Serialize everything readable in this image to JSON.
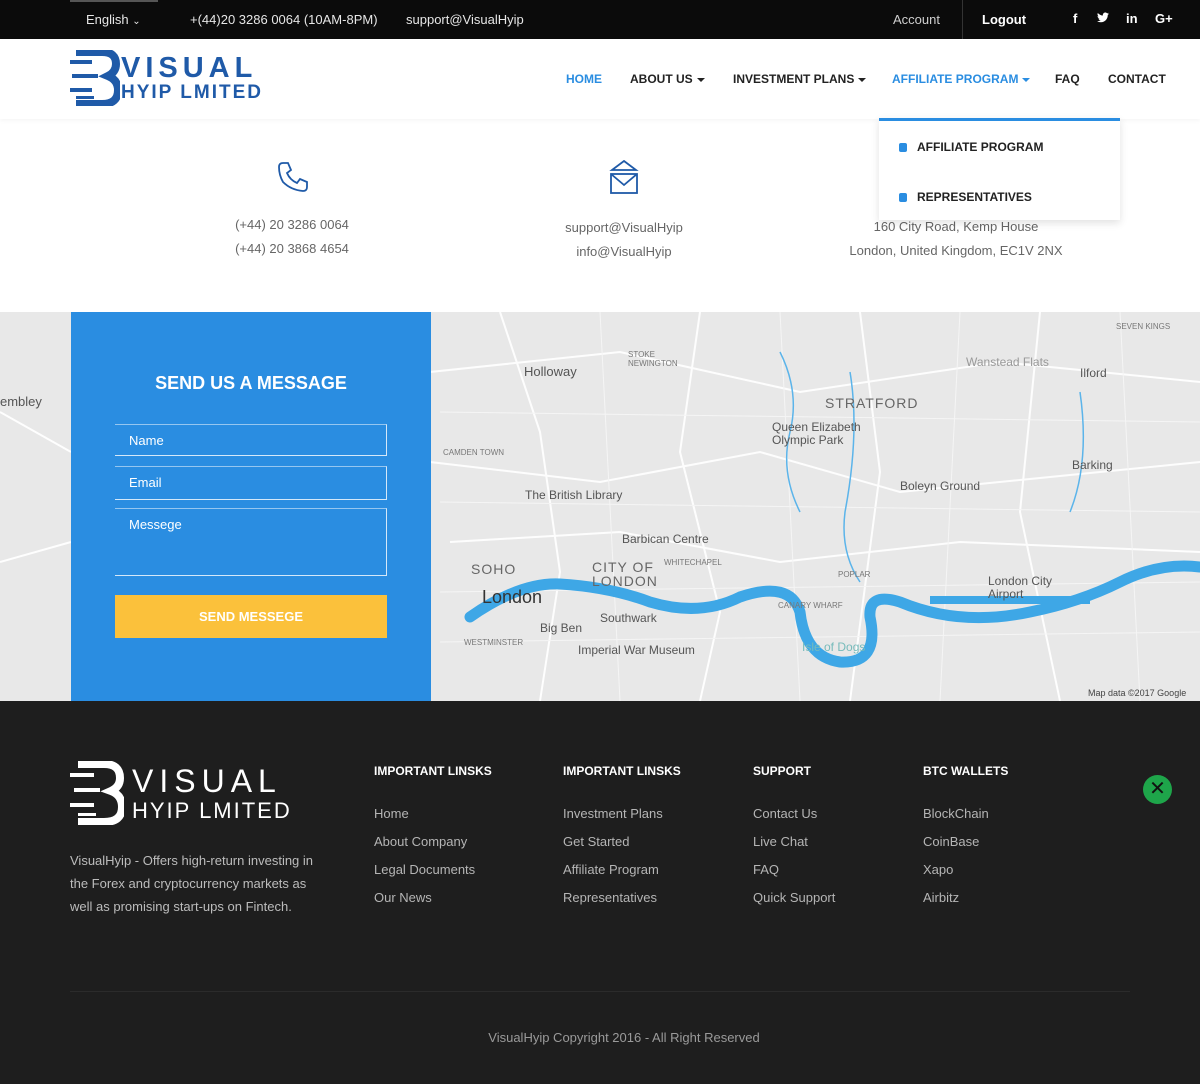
{
  "topbar": {
    "language": "English",
    "phone": "+(44)20 3286 0064 (10AM-8PM)",
    "email": "support@VisualHyip",
    "account": "Account",
    "logout": "Logout",
    "social": [
      "f",
      "t",
      "in",
      "G+"
    ]
  },
  "brand": {
    "line1": "VISUAL",
    "line2": "HYIP LMITED"
  },
  "nav": {
    "home": "HOME",
    "about": "ABOUT US",
    "plans": "INVESTMENT PLANS",
    "affiliate": "AFFILIATE PROGRAM",
    "faq": "FAQ",
    "contact": "CONTACT"
  },
  "dropdown": {
    "item1": "AFFILIATE PROGRAM",
    "item2": "REPRESENTATIVES"
  },
  "contact": {
    "phone1": "(+44) 20 3286 0064",
    "phone2": "(+44) 20 3868 4654",
    "email1": "support@VisualHyip",
    "email2": "info@VisualHyip",
    "address1": "160 City Road, Kemp House",
    "address2": "London, United Kingdom, EC1V 2NX"
  },
  "form": {
    "title": "SEND US A MESSAGE",
    "name_placeholder": "Name",
    "email_placeholder": "Email",
    "message_placeholder": "Messege",
    "send_label": "SEND MESSEGE"
  },
  "map": {
    "labels": {
      "holloway": "Holloway",
      "stratford": "STRATFORD",
      "queen": "Queen Elizabeth Olympic Park",
      "ilford": "Ilford",
      "barking": "Barking",
      "boleyn": "Boleyn Ground",
      "british_library": "The British Library",
      "barbican": "Barbican Centre",
      "soho": "SOHO",
      "city": "CITY OF LONDON",
      "london": "London",
      "southwark": "Southwark",
      "bigben": "Big Ben",
      "iwm": "Imperial War Museum",
      "airport": "London City Airport",
      "wembley": "embley",
      "camden": "CAMDEN TOWN",
      "whitechapel": "WHITECHAPEL",
      "poplar": "POPLAR",
      "canary": "CANARY WHARF",
      "isle": "Isle of Dogs",
      "westminster": "WESTMINSTER",
      "stoke": "STOKE NEWINGTON",
      "seven_kings": "SEVEN KINGS",
      "wanstead": "Wanstead Flats",
      "copyright": "Map data ©2017 Google"
    }
  },
  "footer": {
    "description": "VisualHyip - Offers high-return investing in the Forex and cryptocurrency markets as well as promising start-ups on Fintech.",
    "col1": {
      "heading": "IMPORTANT LINSKS",
      "links": [
        "Home",
        "About Company",
        "Legal Documents",
        "Our News"
      ]
    },
    "col2": {
      "heading": "IMPORTANT LINSKS",
      "links": [
        "Investment Plans",
        "Get Started",
        "Affiliate Program",
        "Representatives"
      ]
    },
    "col3": {
      "heading": "SUPPORT",
      "links": [
        "Contact Us",
        "Live Chat",
        "FAQ",
        "Quick Support"
      ]
    },
    "col4": {
      "heading": "BTC WALLETS",
      "links": [
        "BlockChain",
        "CoinBase",
        "Xapo",
        "Airbitz"
      ]
    },
    "copyright": "VisualHyip Copyright 2016 - All Right Reserved"
  },
  "colors": {
    "accent": "#2a8de1",
    "button": "#fbc13b",
    "footer_bg": "#1e1e1e",
    "topbar_bg": "#0b0b0b"
  }
}
